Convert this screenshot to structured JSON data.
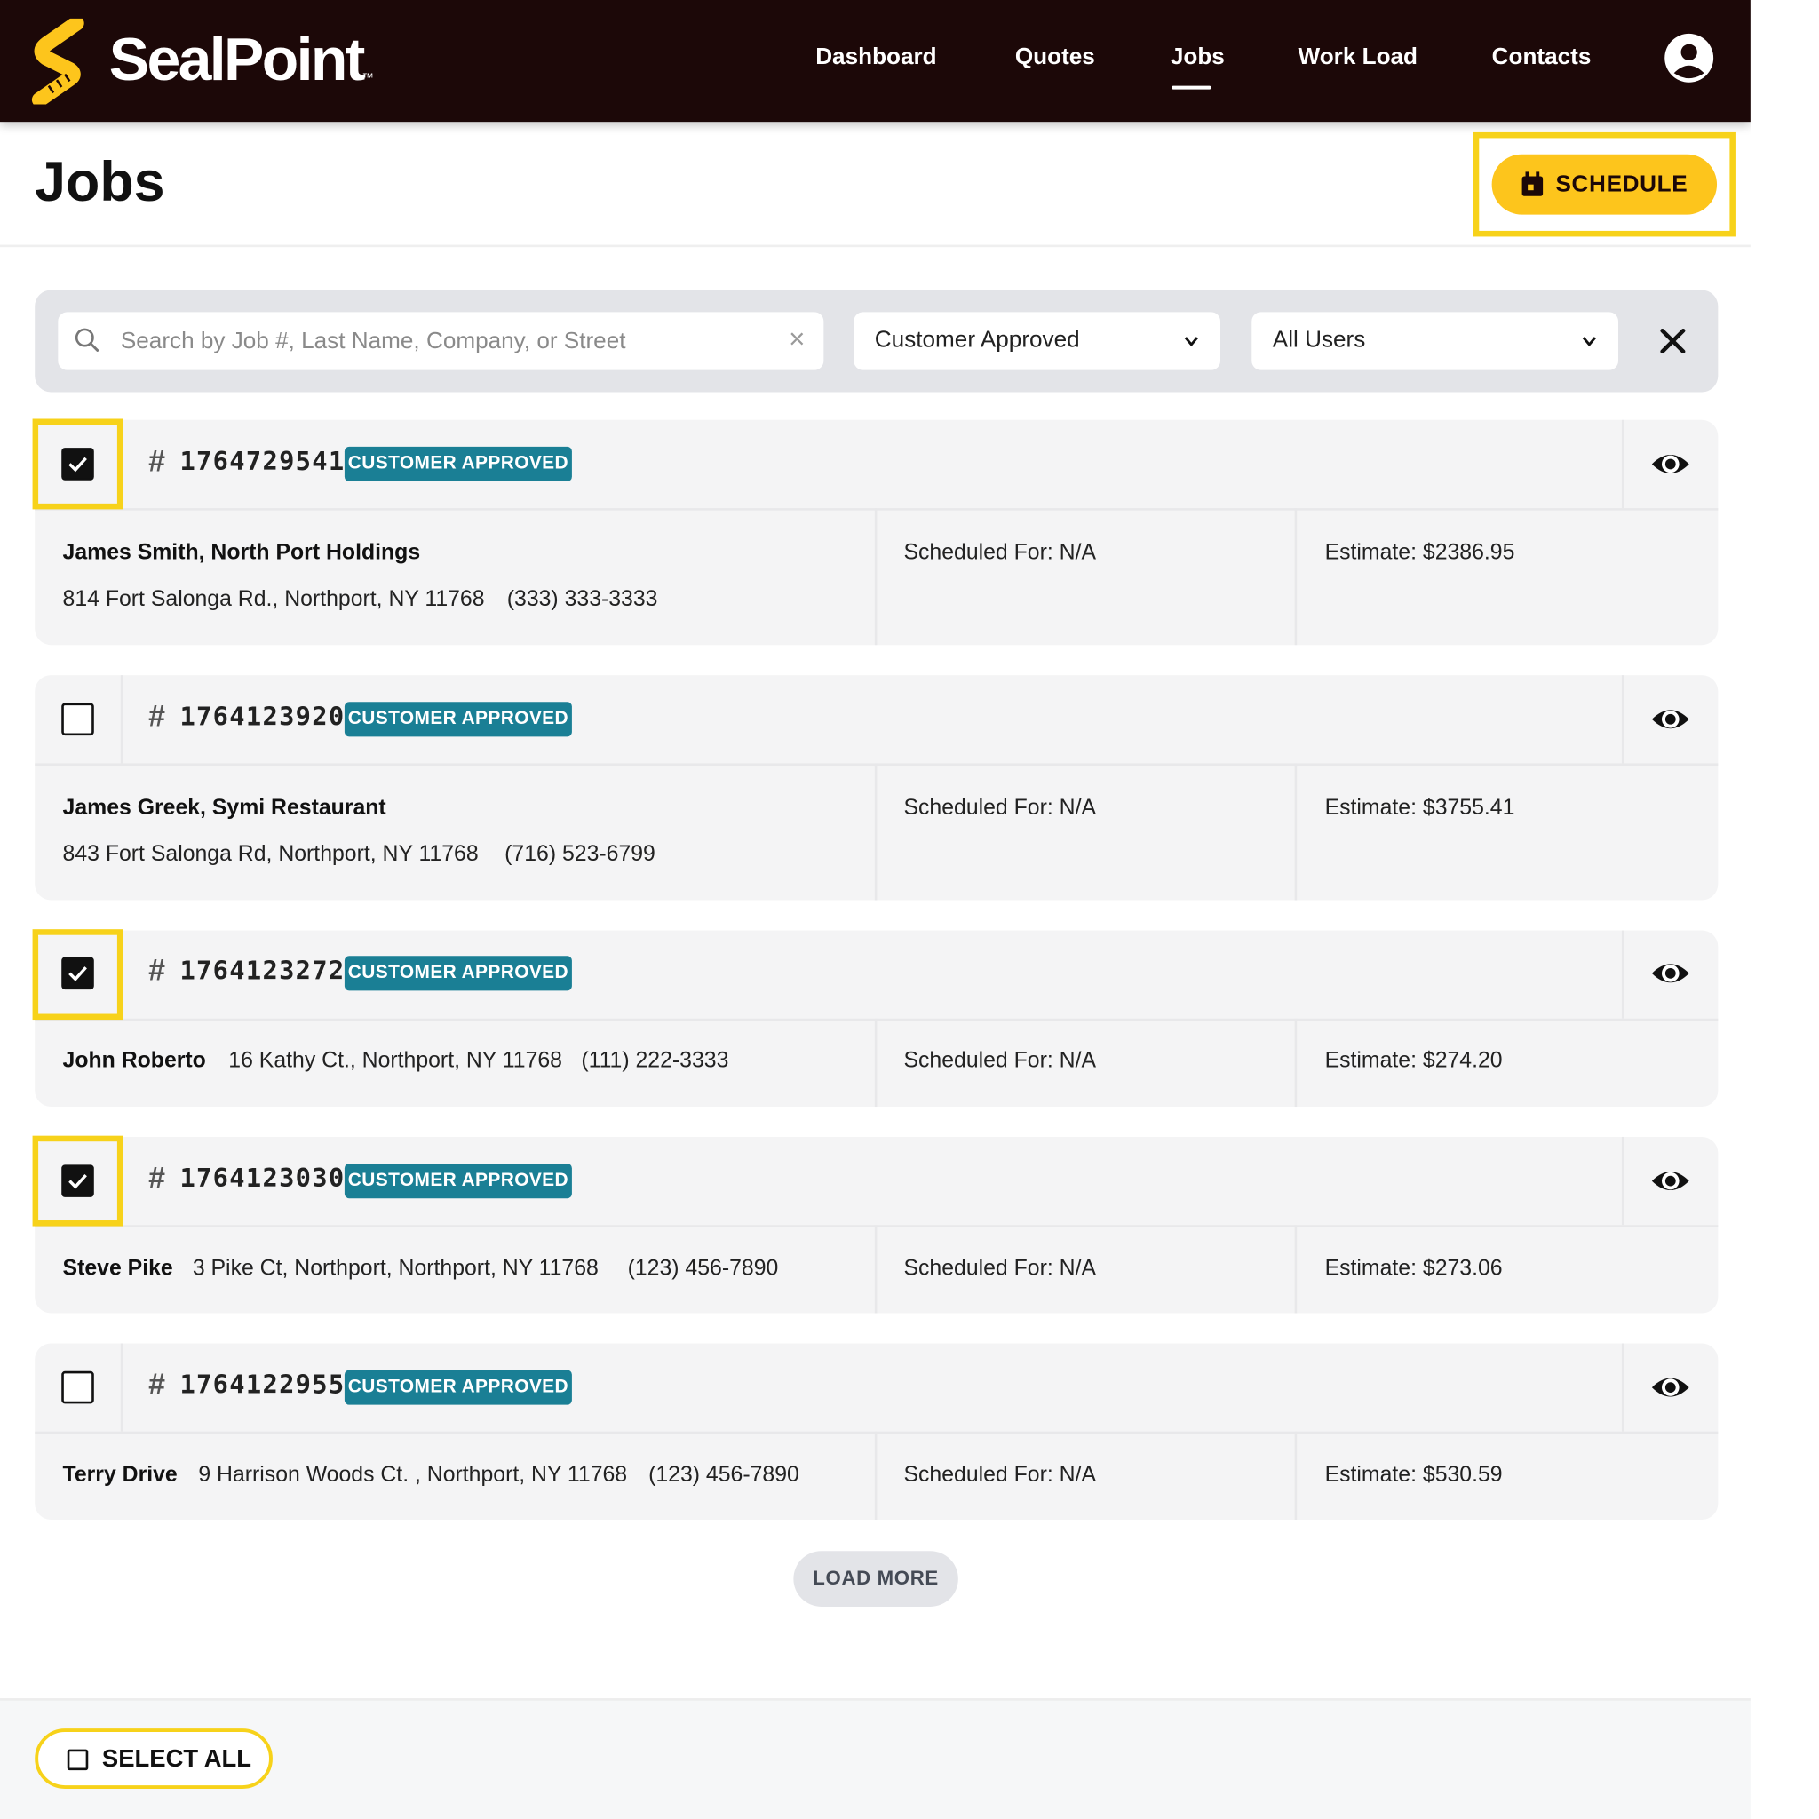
{
  "brand": {
    "name": "SealPoint",
    "trademark": "™",
    "accent_color": "#fdc51c",
    "nav_bg": "#1c0808"
  },
  "nav": {
    "links": [
      {
        "label": "Dashboard",
        "active": false
      },
      {
        "label": "Quotes",
        "active": false
      },
      {
        "label": "Jobs",
        "active": true
      },
      {
        "label": "Work Load",
        "active": false
      },
      {
        "label": "Contacts",
        "active": false
      }
    ],
    "avatar_icon": "user-circle-icon"
  },
  "header": {
    "title": "Jobs",
    "schedule_label": "SCHEDULE",
    "schedule_icon": "calendar-icon"
  },
  "filters": {
    "search_placeholder": "Search by Job #, Last Name, Company, or Street",
    "search_value": "",
    "status_value": "Customer Approved",
    "user_value": "All Users"
  },
  "jobs": [
    {
      "number": "1764729541",
      "checked": true,
      "status": "CUSTOMER APPROVED",
      "name": "James Smith, North Port Holdings",
      "address": "814 Fort Salonga Rd., Northport, NY 11768",
      "phone": "(333) 333-3333",
      "scheduled": "Scheduled For: N/A",
      "estimate": "Estimate: $2386.95"
    },
    {
      "number": "1764123920",
      "checked": false,
      "status": "CUSTOMER APPROVED",
      "name": "James Greek, Symi Restaurant",
      "address": "843 Fort Salonga Rd, Northport, NY 11768",
      "phone": "(716) 523-6799",
      "scheduled": "Scheduled For: N/A",
      "estimate": "Estimate: $3755.41"
    },
    {
      "number": "1764123272",
      "checked": true,
      "status": "CUSTOMER APPROVED",
      "name": "John Roberto",
      "address": "16 Kathy Ct., Northport, NY 11768",
      "phone": "(111) 222-3333",
      "scheduled": "Scheduled For: N/A",
      "estimate": "Estimate: $274.20"
    },
    {
      "number": "1764123030",
      "checked": true,
      "status": "CUSTOMER APPROVED",
      "name": "Steve Pike",
      "address": "3 Pike Ct, Northport, Northport, NY 11768",
      "phone": "(123) 456-7890",
      "scheduled": "Scheduled For: N/A",
      "estimate": "Estimate: $273.06"
    },
    {
      "number": "1764122955",
      "checked": false,
      "status": "CUSTOMER APPROVED",
      "name": "Terry Drive",
      "address": "9 Harrison Woods Ct. , Northport, NY 11768",
      "phone": "(123) 456-7890",
      "scheduled": "Scheduled For: N/A",
      "estimate": "Estimate: $530.59"
    }
  ],
  "load_more_label": "LOAD MORE",
  "footer": {
    "select_all_label": "SELECT ALL"
  }
}
